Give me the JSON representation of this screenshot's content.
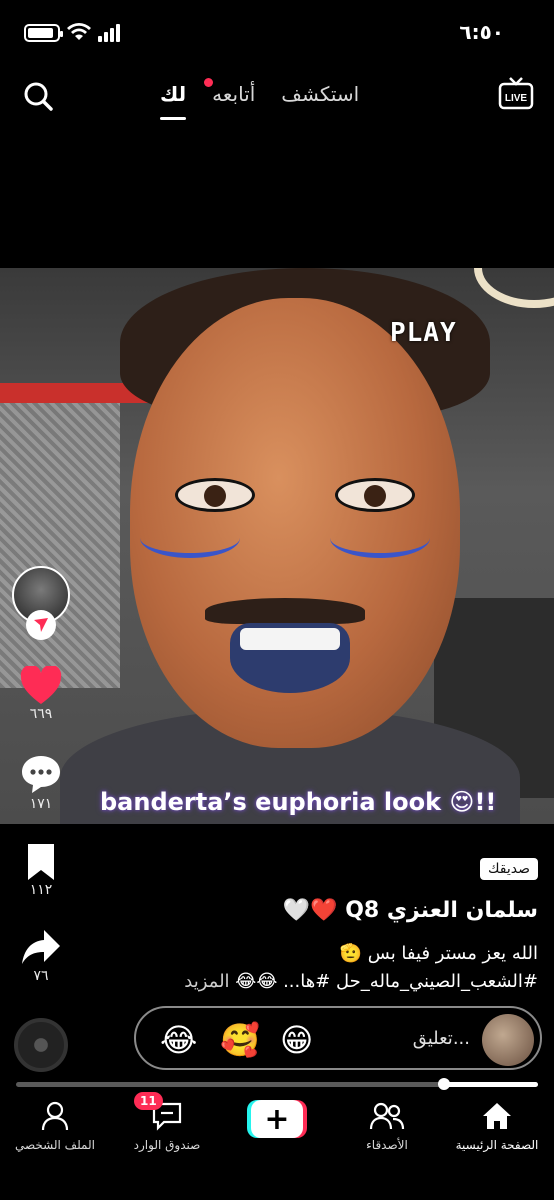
{
  "status": {
    "time": "٦:٥٠",
    "battery_level": 0.9
  },
  "top_nav": {
    "tabs": [
      {
        "label": "لك",
        "active": true
      },
      {
        "label": "أتابعه",
        "active": false,
        "has_dot": true
      },
      {
        "label": "استكشف",
        "active": false
      }
    ],
    "live_label": "LIVE",
    "search_icon": "search-icon"
  },
  "video": {
    "overlay_top": "PLAY",
    "overlay_caption": "banderta’s euphoria look 😍!!"
  },
  "actions": {
    "likes": "٦٦٩",
    "comments": "١٧١",
    "saves": "١١٢",
    "shares": "٧٦"
  },
  "post": {
    "friend_badge": "صديقك",
    "username": "سلمان العنزي Q8 ❤️🤍",
    "description": "الله يعز مستر فيفا بس 🫡 #الشعب_الصيني_ماله_حل #ها... 😂😂",
    "more": "المزيد"
  },
  "comment": {
    "placeholder": "تعليق...",
    "emojis": [
      "😂",
      "🥰",
      "😁"
    ]
  },
  "progress": {
    "fraction": 0.18
  },
  "bottom_nav": {
    "home": "الصفحة الرئيسية",
    "friends": "الأصدقاء",
    "inbox": "صندوق الوارد",
    "inbox_badge": "11",
    "profile": "الملف الشخصي",
    "create": "+"
  }
}
